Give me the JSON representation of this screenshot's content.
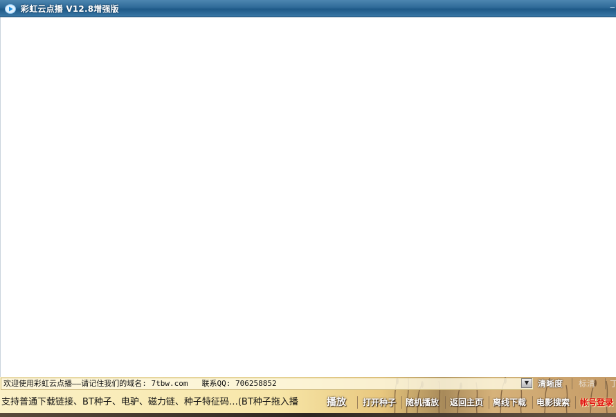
{
  "window": {
    "title": "彩虹云点播 V12.8增强版",
    "icon": "play-icon",
    "corner_glyph": "‒"
  },
  "notice_bar": {
    "welcome_text": "欢迎使用彩虹云点播——请记住我们的域名: 7tbw.com",
    "qq_text": "联系QQ: 706258852",
    "dropdown_icon": "dropdown-arrow-icon",
    "dropdown_glyph": "▼"
  },
  "quality": {
    "hd_label": "清晰度",
    "sd_label": "标清",
    "edge_glyph": "丁"
  },
  "ticker": {
    "text": "支持普通下载链接、BT种子、电驴、磁力链、种子特征码…(BT种子拖入播"
  },
  "toolbar": {
    "play_label": "播放",
    "open_torrent_label": "打开种子",
    "random_play_label": "随机播放",
    "home_label": "返回主页",
    "offline_download_label": "离线下载",
    "movie_search_label": "电影搜索",
    "account_login_label": "帐号登录"
  },
  "colors": {
    "title_bar": "#2f6a98",
    "bottom_panel": "#f7e6a8",
    "login_text": "#e01010"
  }
}
